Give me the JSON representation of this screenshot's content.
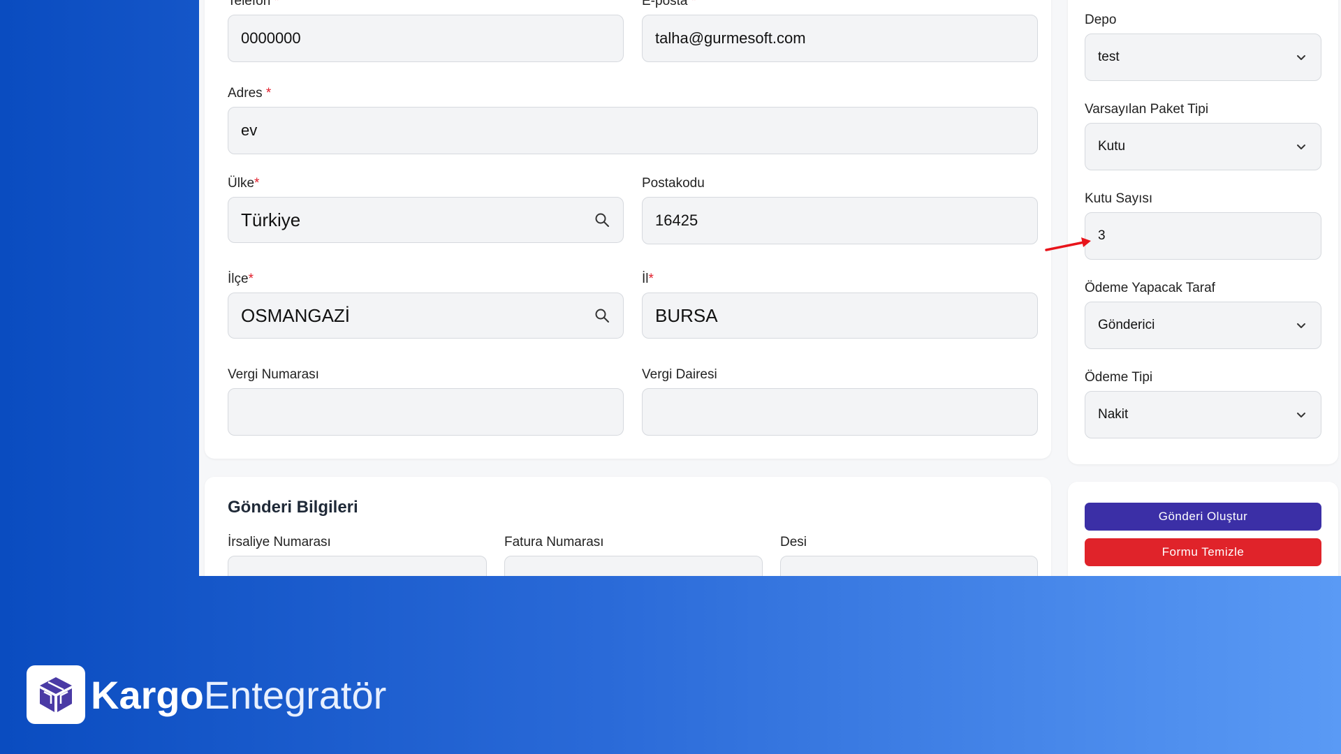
{
  "form": {
    "phone": {
      "label": "Telefon",
      "required": "*",
      "value": "0000000"
    },
    "email": {
      "label": "E-posta",
      "required": "*",
      "value": "talha@gurmesoft.com"
    },
    "address": {
      "label": "Adres",
      "required": "*",
      "value": "ev"
    },
    "country": {
      "label": "Ülke",
      "required": "*",
      "value": "Türkiye",
      "icon": "search-icon"
    },
    "postcode": {
      "label": "Postakodu",
      "value": "16425"
    },
    "district": {
      "label": "İlçe",
      "required": "*",
      "value": "OSMANGAZİ",
      "icon": "search-icon"
    },
    "city": {
      "label": "İl",
      "required": "*",
      "value": "BURSA"
    },
    "tax_number": {
      "label": "Vergi Numarası",
      "value": ""
    },
    "tax_office": {
      "label": "Vergi Dairesi",
      "value": ""
    }
  },
  "shipment": {
    "title": "Gönderi Bilgileri",
    "waybill": {
      "label": "İrsaliye Numarası",
      "value": ""
    },
    "invoice": {
      "label": "Fatura Numarası",
      "value": ""
    },
    "desi": {
      "label": "Desi",
      "value": ""
    }
  },
  "sidebar": {
    "warehouse": {
      "label": "Depo",
      "value": "test"
    },
    "package_type": {
      "label": "Varsayılan Paket Tipi",
      "value": "Kutu"
    },
    "box_count": {
      "label": "Kutu Sayısı",
      "value": "3"
    },
    "payer": {
      "label": "Ödeme Yapacak Taraf",
      "value": "Gönderici"
    },
    "payment_type": {
      "label": "Ödeme Tipi",
      "value": "Nakit"
    }
  },
  "actions": {
    "create_label": "Gönderi Oluştur",
    "clear_label": "Formu Temizle",
    "create_color": "#3b2fa6",
    "clear_color": "#e0232a"
  },
  "annotation": {
    "arrow_color": "#e8141b"
  },
  "brand": {
    "name_bold": "Kargo",
    "name_light": "Entegratör",
    "logo_icon": "box-icon"
  }
}
